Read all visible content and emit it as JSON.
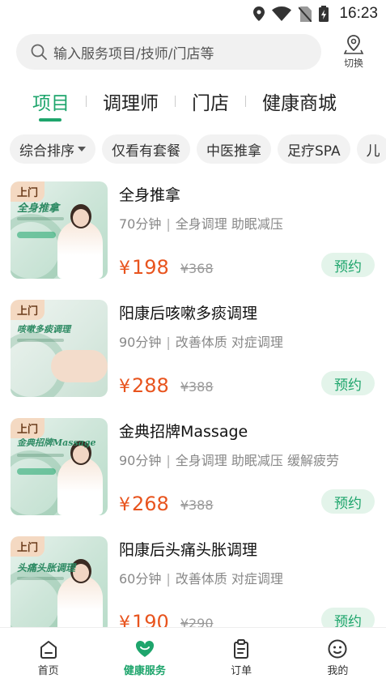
{
  "status_bar": {
    "time": "16:23"
  },
  "search": {
    "placeholder": "输入服务项目/技师/门店等",
    "switch_label": "切换"
  },
  "tabs": [
    {
      "label": "项目",
      "active": true
    },
    {
      "label": "调理师"
    },
    {
      "label": "门店"
    },
    {
      "label": "健康商城"
    }
  ],
  "filters": [
    {
      "label": "综合排序",
      "has_caret": true
    },
    {
      "label": "仅看有套餐"
    },
    {
      "label": "中医推拿"
    },
    {
      "label": "足疗SPA"
    },
    {
      "label": "儿"
    }
  ],
  "services": [
    {
      "badge": "上门",
      "thumb_title": "全身推拿",
      "name": "全身推拿",
      "duration": "70分钟",
      "tags": "全身调理 助眠减压",
      "price": "198",
      "original_price": "¥368",
      "book_label": "预约"
    },
    {
      "badge": "上门",
      "thumb_title": "咳嗽多痰调理",
      "name": "阳康后咳嗽多痰调理",
      "duration": "90分钟",
      "tags": "改善体质 对症调理",
      "price": "288",
      "original_price": "¥388",
      "book_label": "预约"
    },
    {
      "badge": "上门",
      "thumb_title": "金典招牌Massage",
      "name": "金典招牌Massage",
      "duration": "90分钟",
      "tags": "全身调理 助眠减压 缓解疲劳",
      "price": "268",
      "original_price": "¥388",
      "book_label": "预约"
    },
    {
      "badge": "上门",
      "thumb_title": "头痛头胀调理",
      "name": "阳康后头痛头胀调理",
      "duration": "60分钟",
      "tags": "改善体质 对症调理",
      "price": "190",
      "original_price": "¥290",
      "book_label": "预约"
    }
  ],
  "currency_symbol": "¥",
  "bottom_nav": [
    {
      "label": "首页",
      "icon": "home-icon"
    },
    {
      "label": "健康服务",
      "icon": "heart-icon",
      "active": true
    },
    {
      "label": "订单",
      "icon": "clipboard-icon"
    },
    {
      "label": "我的",
      "icon": "face-icon"
    }
  ],
  "colors": {
    "accent": "#1ea56c",
    "price": "#e8541e",
    "badge_bg": "#f4d9c2"
  }
}
